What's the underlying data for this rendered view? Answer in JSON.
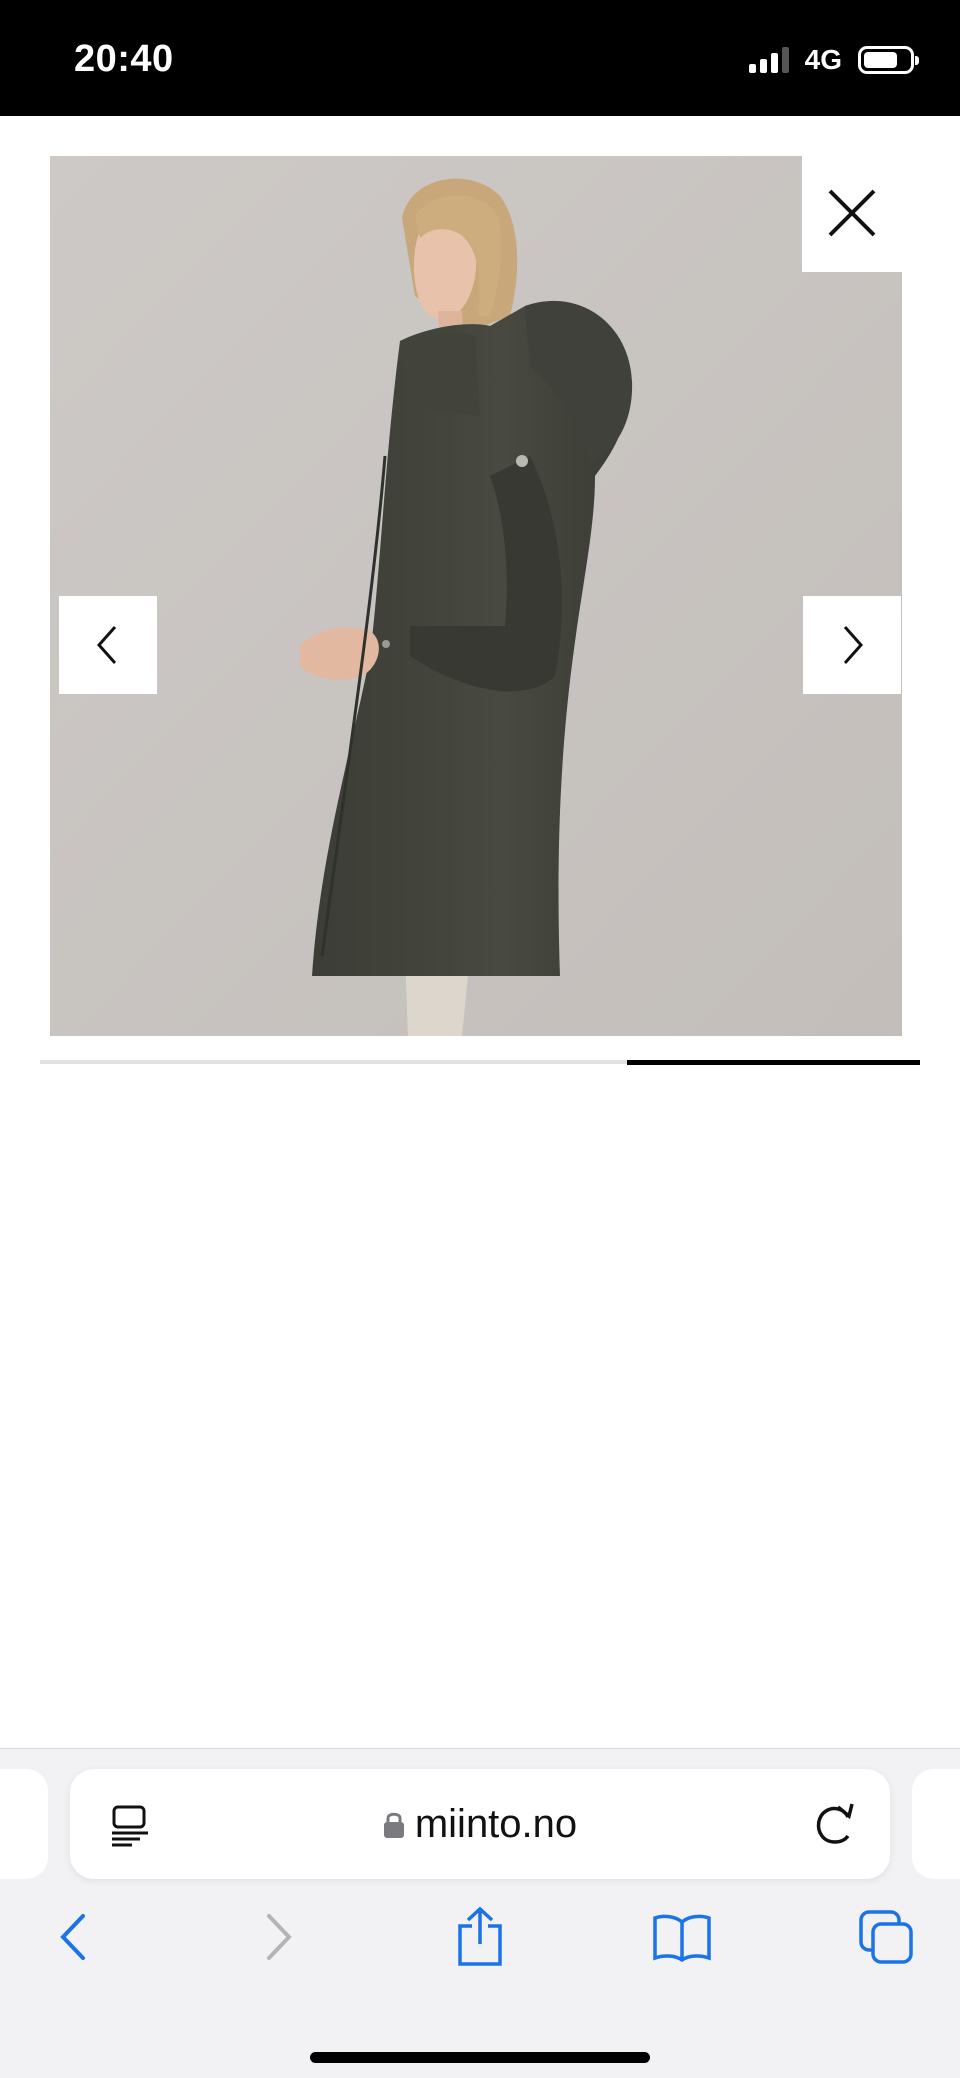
{
  "status_bar": {
    "time": "20:40",
    "network": "4G",
    "signal_bars": 3,
    "battery_level": 0.75
  },
  "gallery": {
    "prev_icon": "chevron-left-icon",
    "next_icon": "chevron-right-icon",
    "close_icon": "close-icon",
    "slide_progress_start": 0.667,
    "slide_progress_end": 1.0
  },
  "browser": {
    "url": "miinto.no",
    "secure_icon": "lock-icon",
    "reader_icon": "reader-mode-icon",
    "reload_icon": "reload-icon",
    "toolbar": [
      "back-icon",
      "forward-icon",
      "share-icon",
      "bookmarks-icon",
      "tabs-icon"
    ],
    "accent_color": "#1a73e8"
  }
}
